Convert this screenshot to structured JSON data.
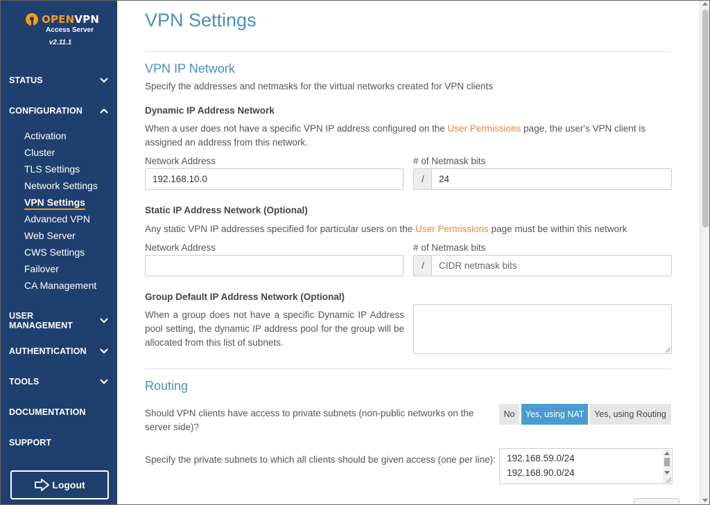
{
  "brand": {
    "name_part1": "OPEN",
    "name_part2": "VPN",
    "subtitle": "Access Server",
    "version": "v2.11.1",
    "accent_color": "#f29c1f"
  },
  "sidebar": {
    "background": "#1f3f6e",
    "sections": [
      {
        "label": "STATUS",
        "icon": "chevron-down-icon"
      },
      {
        "label": "CONFIGURATION",
        "icon": "chevron-up-icon"
      },
      {
        "label": "USER MANAGEMENT",
        "icon": "chevron-down-icon"
      },
      {
        "label": "AUTHENTICATION",
        "icon": "chevron-down-icon"
      },
      {
        "label": "TOOLS",
        "icon": "chevron-down-icon"
      },
      {
        "label": "DOCUMENTATION"
      },
      {
        "label": "SUPPORT"
      }
    ],
    "config_items": [
      {
        "label": "Activation"
      },
      {
        "label": "Cluster"
      },
      {
        "label": "TLS Settings"
      },
      {
        "label": "Network Settings"
      },
      {
        "label": "VPN Settings",
        "active": true
      },
      {
        "label": "Advanced VPN"
      },
      {
        "label": "Web Server"
      },
      {
        "label": "CWS Settings"
      },
      {
        "label": "Failover"
      },
      {
        "label": "CA Management"
      }
    ],
    "logout_label": "Logout",
    "logout_icon": "logout-icon"
  },
  "page": {
    "title": "VPN Settings"
  },
  "vpn_ip_network": {
    "heading": "VPN IP Network",
    "description": "Specify the addresses and netmasks for the virtual networks created for VPN clients",
    "dynamic": {
      "title": "Dynamic IP Address Network",
      "desc_before": "When a user does not have a specific VPN IP address configured on the ",
      "desc_link": "User Permissions",
      "desc_after": " page, the user's VPN client is assigned an address from this network.",
      "network_label": "Network Address",
      "network_value": "192.168.10.0",
      "netmask_label": "# of Netmask bits",
      "netmask_prefix": "/",
      "netmask_value": "24"
    },
    "static": {
      "title": "Static IP Address Network (Optional)",
      "desc_before": "Any static VPN IP addresses specified for particular users on the ",
      "desc_link": "User Permissions",
      "desc_after": " page must be within this network",
      "network_label": "Network Address",
      "network_value": "",
      "netmask_label": "# of Netmask bits",
      "netmask_prefix": "/",
      "netmask_placeholder": "CIDR netmask bits"
    },
    "group": {
      "title": "Group Default IP Address Network (Optional)",
      "description": "When a group does not have a specific Dynamic IP Address pool setting, the dynamic IP address pool for the group will be allocated from this list of subnets.",
      "value": ""
    }
  },
  "routing": {
    "heading": "Routing",
    "question": "Should VPN clients have access to private subnets (non-public networks on the server side)?",
    "options": [
      {
        "label": "No",
        "selected": false
      },
      {
        "label": "Yes, using NAT",
        "selected": true
      },
      {
        "label": "Yes, using Routing",
        "selected": false
      }
    ],
    "subnets_label": "Specify the private subnets to which all clients should be given access (one per line):",
    "subnets": [
      "192.168.59.0/24",
      "192.168.90.0/24"
    ]
  },
  "colors": {
    "heading": "#4a8ec2",
    "link": "#e08a3c",
    "selected_option": "#4a9bd1"
  }
}
